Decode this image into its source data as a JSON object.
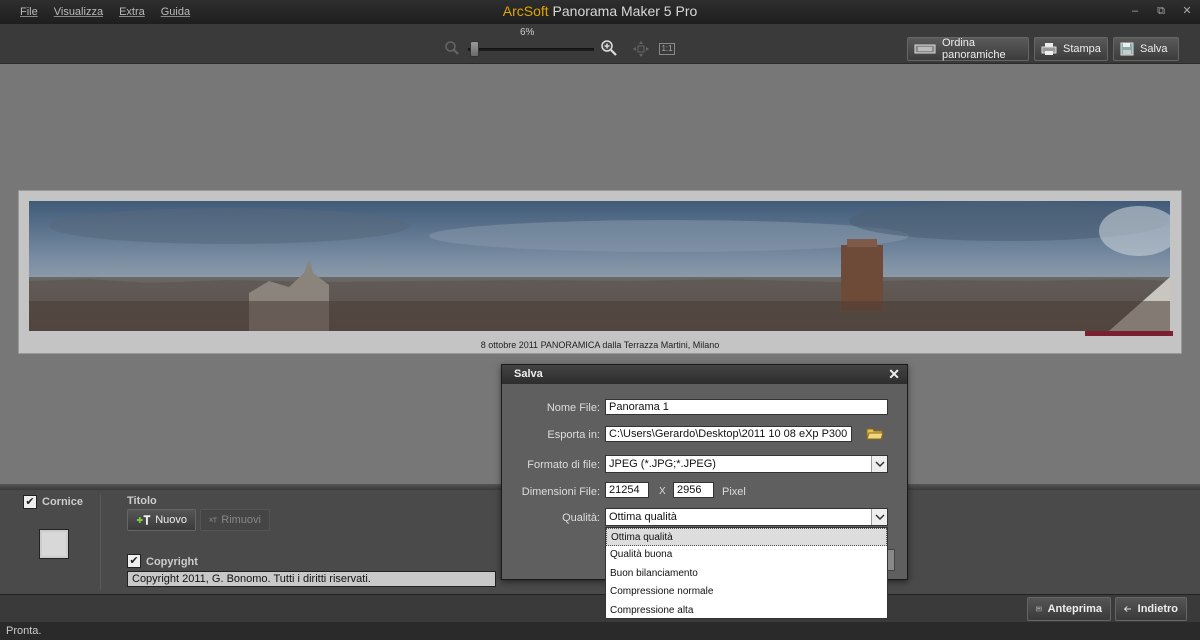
{
  "menu": [
    "File",
    "Visualizza",
    "Extra",
    "Guida"
  ],
  "app": {
    "brand": "ArcSoft",
    "title": " Panorama Maker 5 Pro"
  },
  "window_controls": {
    "minimize": "–",
    "restore": "⧉",
    "close": "✕"
  },
  "toolbar": {
    "zoom": "6%",
    "zoom_fraction": 0.04,
    "actual_size": "1:1",
    "order_label": "Ordina panoramiche",
    "print_label": "Stampa",
    "save_label": "Salva"
  },
  "panorama": {
    "caption": "8 ottobre 2011 PANORAMICA dalla Terrazza Martini, Milano"
  },
  "panel": {
    "frame_label": "Cornice",
    "frame_checked": "✔",
    "title_label": "Titolo",
    "new_label": "Nuovo",
    "remove_label": "Rimuovi",
    "copyright_label": "Copyright",
    "copyright_checked": "✔",
    "copyright_text": "Copyright 2011, G. Bonomo. Tutti i diritti riservati."
  },
  "bottom": {
    "preview_label": "Anteprima",
    "back_label": "Indietro"
  },
  "status": "Pronta.",
  "dialog": {
    "title": "Salva",
    "close": "✕",
    "name_label": "Nome File:",
    "name_value": "Panorama 1",
    "export_label": "Esporta in:",
    "export_value": "C:\\Users\\Gerardo\\Desktop\\2011 10 08 eXp P300 panoram",
    "format_label": "Formato di file:",
    "format_value": "JPEG (*.JPG;*.JPEG)",
    "dims_label": "Dimensioni File:",
    "width": "21254",
    "x": "X",
    "height": "2956",
    "unit": "Pixel",
    "quality_label": "Qualità:",
    "quality_value": "Ottima qualità",
    "quality_options": [
      "Ottima qualità",
      "Qualità buona",
      "Buon bilanciamento",
      "Compressione normale",
      "Compressione alta"
    ]
  }
}
